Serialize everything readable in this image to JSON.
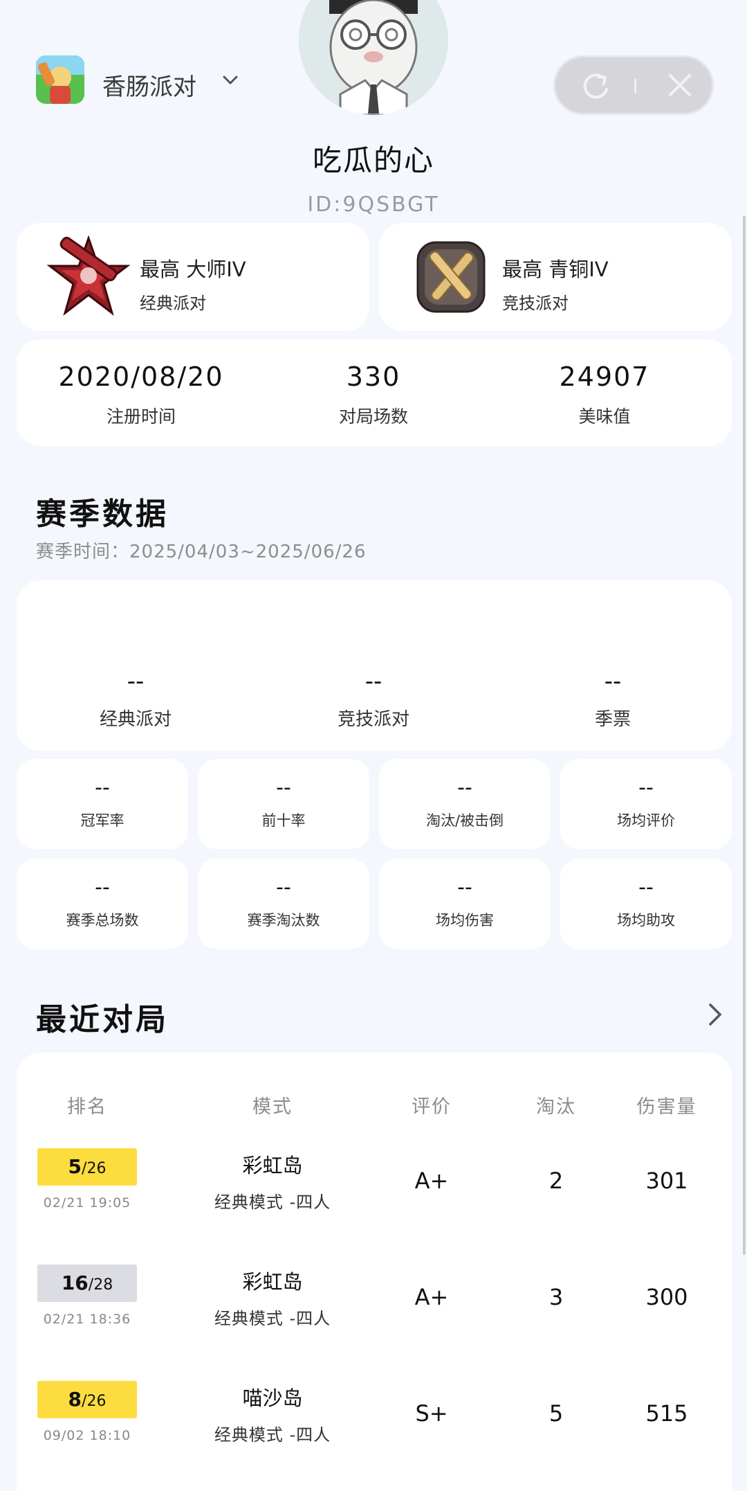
{
  "header": {
    "app_name": "香肠派对",
    "nickname": "吃瓜的心",
    "user_id": "ID:9QSBGT",
    "capsule_icons": [
      "refresh-icon",
      "close-icon"
    ]
  },
  "ranks": [
    {
      "title": "最高 大师IV",
      "mode": "经典派对",
      "icon": "master-star-emblem-icon"
    },
    {
      "title": "最高 青铜IV",
      "mode": "竞技派对",
      "icon": "bronze-shield-emblem-icon"
    }
  ],
  "account_stats": [
    {
      "value": "2020/08/20",
      "label": "注册时间"
    },
    {
      "value": "330",
      "label": "对局场数"
    },
    {
      "value": "24907",
      "label": "美味值"
    }
  ],
  "season": {
    "title": "赛季数据",
    "range": "赛季时间：2025/04/03~2025/06/26",
    "big_stats": [
      {
        "value": "--",
        "label": "经典派对"
      },
      {
        "value": "--",
        "label": "竞技派对"
      },
      {
        "value": "--",
        "label": "季票"
      }
    ],
    "tiles": [
      {
        "value": "--",
        "label": "冠军率"
      },
      {
        "value": "--",
        "label": "前十率"
      },
      {
        "value": "--",
        "label": "淘汰/被击倒"
      },
      {
        "value": "--",
        "label": "场均评价"
      },
      {
        "value": "--",
        "label": "赛季总场数"
      },
      {
        "value": "--",
        "label": "赛季淘汰数"
      },
      {
        "value": "--",
        "label": "场均伤害"
      },
      {
        "value": "--",
        "label": "场均助攻"
      }
    ]
  },
  "recent": {
    "title": "最近对局",
    "headers": [
      "排名",
      "模式",
      "评价",
      "淘汰",
      "伤害量"
    ],
    "rows": [
      {
        "rank": "5",
        "total": "/26",
        "time": "02/21 19:05",
        "map": "彩虹岛",
        "mode": "经典模式 -四人",
        "grade": "A+",
        "kills": "2",
        "damage": "301",
        "badge_color": "#fddc3f"
      },
      {
        "rank": "16",
        "total": "/28",
        "time": "02/21 18:36",
        "map": "彩虹岛",
        "mode": "经典模式 -四人",
        "grade": "A+",
        "kills": "3",
        "damage": "300",
        "badge_color": "#dcdce3"
      },
      {
        "rank": "8",
        "total": "/26",
        "time": "09/02 18:10",
        "map": "喵沙岛",
        "mode": "经典模式 -四人",
        "grade": "S+",
        "kills": "5",
        "damage": "515",
        "badge_color": "#fddc3f"
      }
    ]
  }
}
